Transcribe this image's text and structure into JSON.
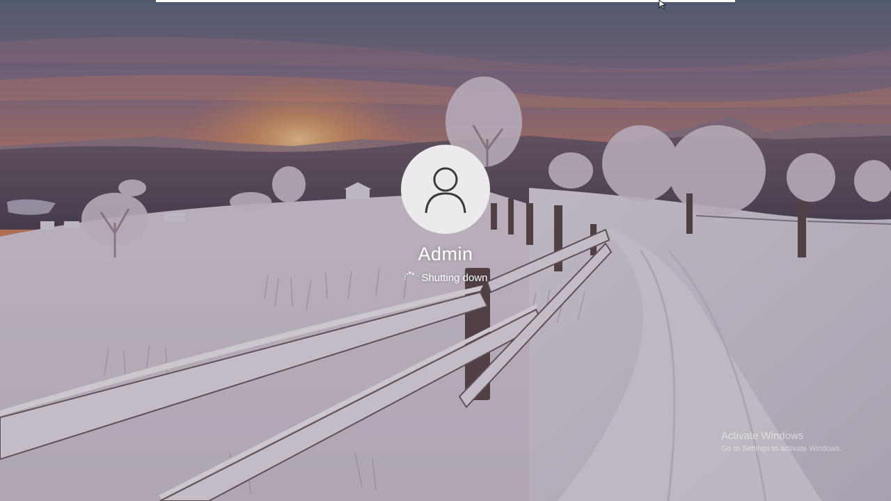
{
  "user": {
    "name": "Admin",
    "status": "Shutting down"
  },
  "watermark": {
    "title": "Activate Windows",
    "subtitle": "Go to Settings to activate Windows."
  },
  "icons": {
    "avatar": "user-silhouette-icon",
    "progress": "loading-spinner-icon",
    "pointer": "mouse-cursor-icon"
  },
  "colors": {
    "avatar_bg": "#eceaec",
    "avatar_glyph": "#3a3a3a",
    "text": "#ffffff"
  }
}
